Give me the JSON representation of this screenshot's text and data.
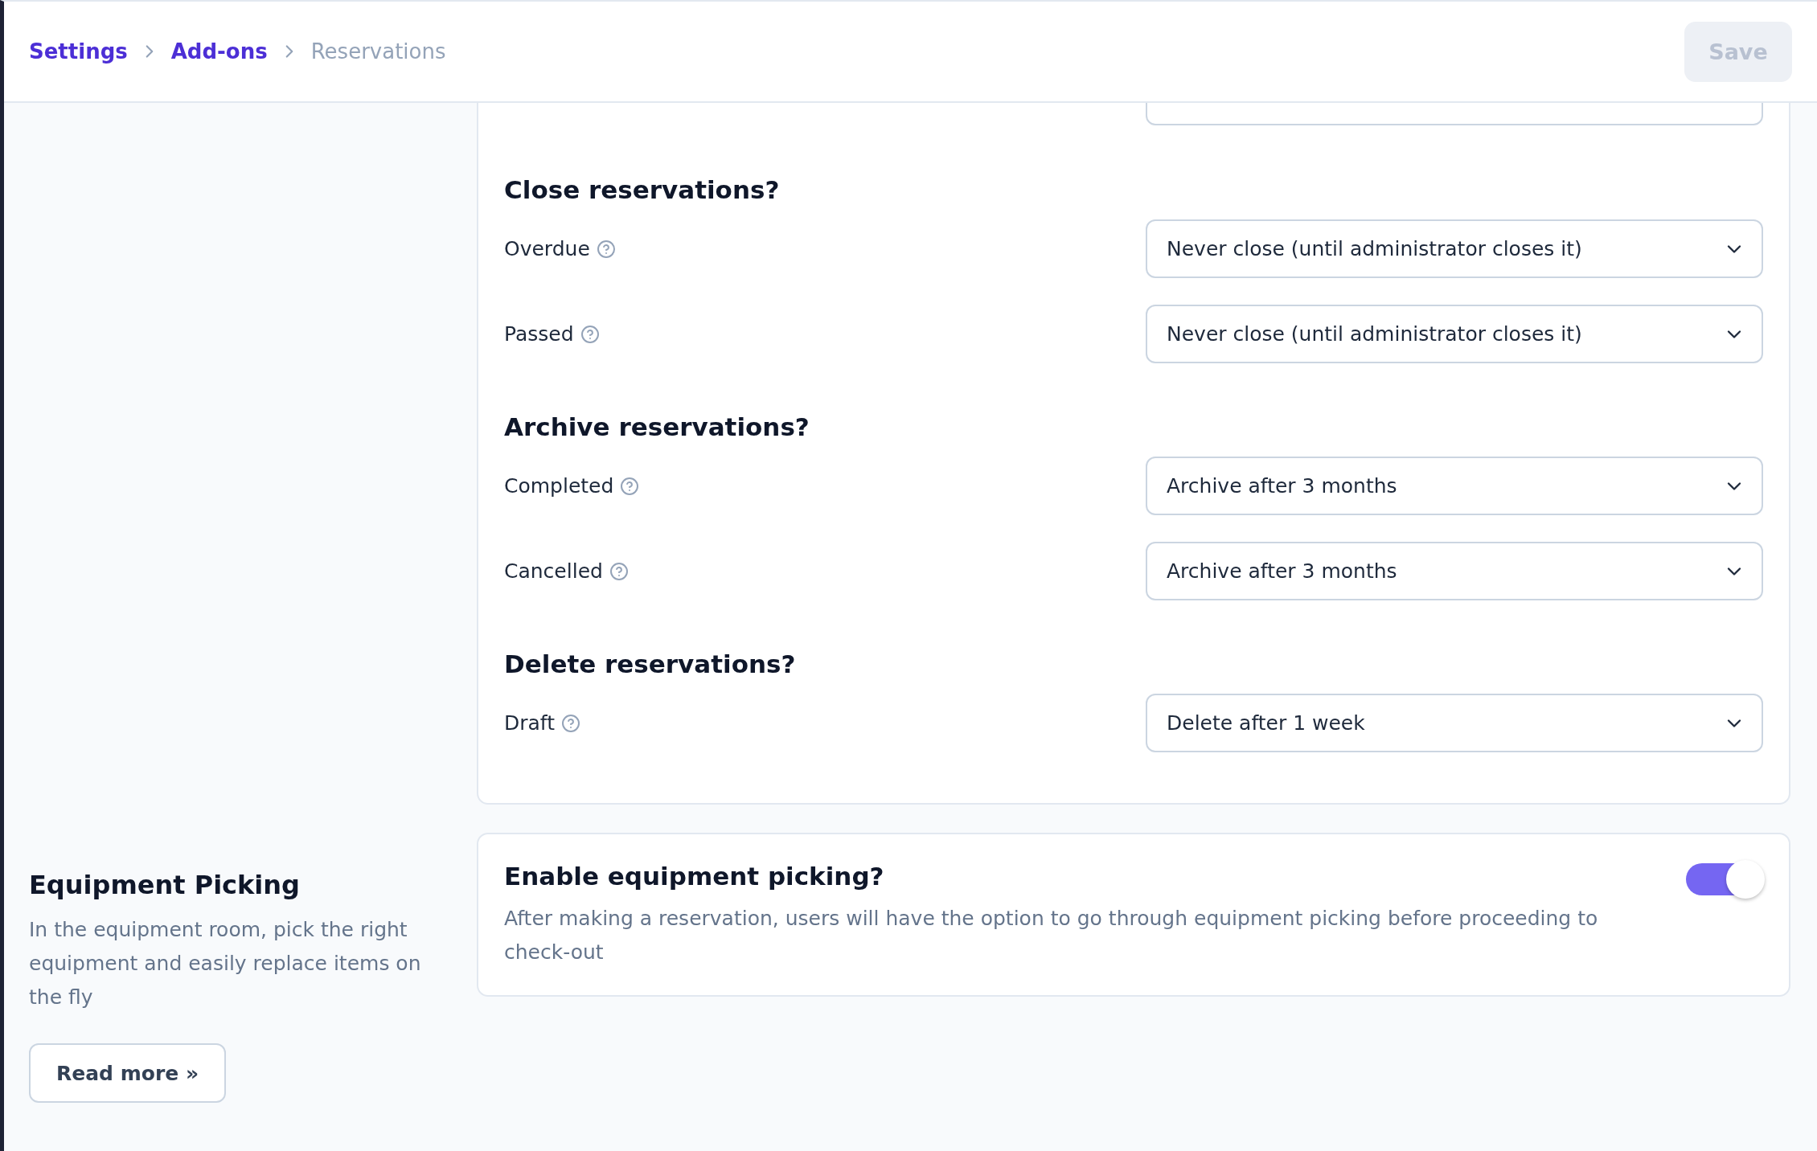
{
  "breadcrumb": [
    {
      "label": "Settings",
      "kind": "link"
    },
    {
      "label": "Add-ons",
      "kind": "link"
    },
    {
      "label": "Reservations",
      "kind": "current"
    }
  ],
  "save_button": {
    "label": "Save",
    "disabled": true
  },
  "sections": [
    {
      "title": "Close reservations?",
      "rows": [
        {
          "label": "Overdue",
          "value": "Never close (until administrator closes it)"
        },
        {
          "label": "Passed",
          "value": "Never close (until administrator closes it)"
        }
      ]
    },
    {
      "title": "Archive reservations?",
      "rows": [
        {
          "label": "Completed",
          "value": "Archive after 3 months"
        },
        {
          "label": "Cancelled",
          "value": "Archive after 3 months"
        }
      ]
    },
    {
      "title": "Delete reservations?",
      "rows": [
        {
          "label": "Draft",
          "value": "Delete after 1 week"
        }
      ]
    }
  ],
  "equipment_picking": {
    "title": "Equipment Picking",
    "description": "In the equipment room, pick the right equipment and easily replace items on the fly",
    "read_more": "Read more »",
    "setting": {
      "title": "Enable equipment picking?",
      "description": "After making a reservation, users will have the option to go through equipment picking before proceeding to check-out",
      "on": true
    }
  }
}
